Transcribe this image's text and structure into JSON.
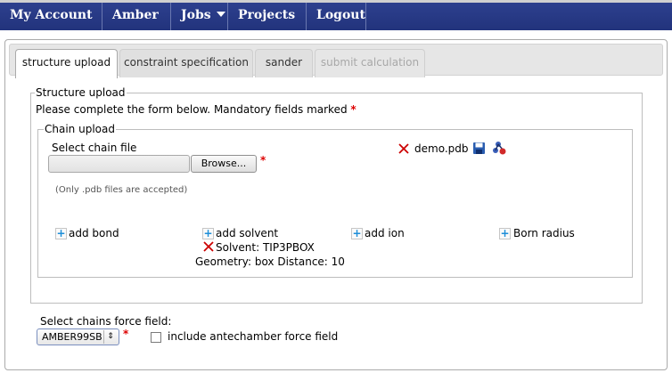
{
  "menu": {
    "items": [
      {
        "label": "My Account",
        "dropdown": true
      },
      {
        "label": "Amber",
        "dropdown": true
      },
      {
        "label": "Jobs",
        "dropdown": true
      },
      {
        "label": "Projects",
        "dropdown": true
      },
      {
        "label": "Logout",
        "dropdown": false
      }
    ]
  },
  "tabs": [
    {
      "label": "structure upload",
      "state": "active"
    },
    {
      "label": "constraint specification",
      "state": "normal"
    },
    {
      "label": "sander",
      "state": "normal"
    },
    {
      "label": "submit calculation",
      "state": "disabled"
    }
  ],
  "structure_upload": {
    "legend": "Structure upload",
    "instruction": "Please complete the form below. Mandatory fields marked",
    "required_marker": "*"
  },
  "chain_upload": {
    "legend": "Chain upload",
    "select_label": "Select chain file",
    "browse_label": "Browse...",
    "note": "(Only .pdb files are accepted)",
    "uploaded_file": "demo.pdb",
    "actions": {
      "add_bond": "add bond",
      "add_solvent": "add solvent",
      "add_ion": "add ion",
      "born_radius": "Born radius"
    },
    "solvent": {
      "name": "Solvent: TIP3PBOX",
      "geometry": "Geometry: box Distance: 10"
    }
  },
  "force_field": {
    "label": "Select chains force field:",
    "selected": "AMBER99SB",
    "antechamber_label": "include antechamber force field",
    "antechamber_checked": false
  },
  "colors": {
    "menubar": "#283a86",
    "required": "#dd0000",
    "plus": "#1d8ed8",
    "remove": "#cc0000"
  }
}
